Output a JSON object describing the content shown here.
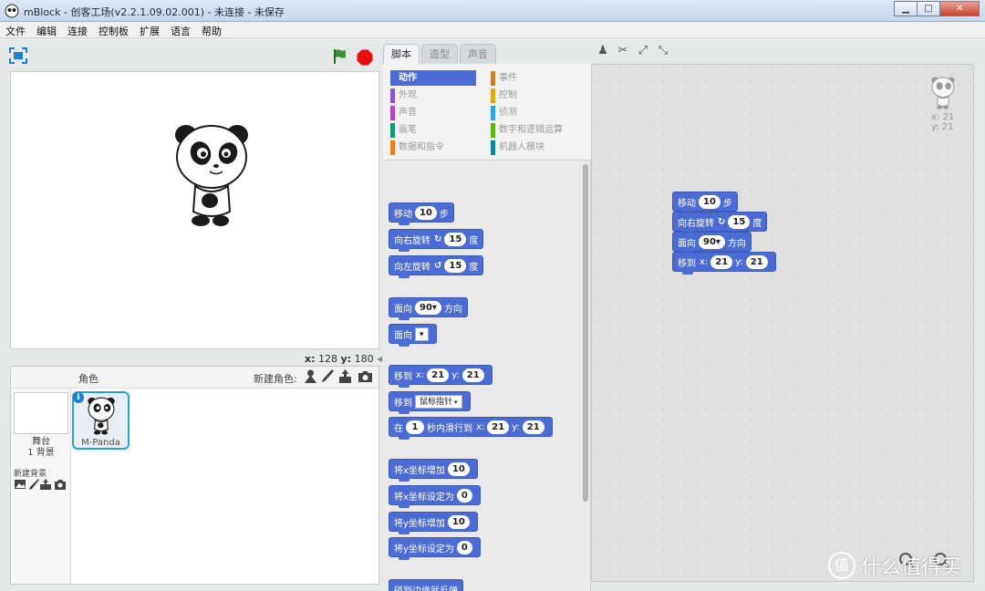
{
  "window": {
    "title": "mBlock - 创客工场(v2.2.1.09.02.001) - 未连接 - 未保存",
    "minimize": "▁",
    "maximize": "□",
    "close": "✕"
  },
  "menu": [
    "文件",
    "编辑",
    "连接",
    "控制板",
    "扩展",
    "语言",
    "帮助"
  ],
  "stage": {
    "coords": {
      "x_label": "x:",
      "x_value": "128",
      "y_label": "y:",
      "y_value": "180"
    }
  },
  "sprites": {
    "title": "角色",
    "new_sprite_label": "新建角色:",
    "stage_label_1": "舞台",
    "stage_label_2": "1 背景",
    "new_backdrop_label": "新建背景",
    "items": [
      {
        "name": "M-Panda",
        "info": "i"
      }
    ]
  },
  "tabs": [
    "脚本",
    "造型",
    "声音"
  ],
  "categories": [
    {
      "label": "动作",
      "color": "#4a6cd4",
      "active": true
    },
    {
      "label": "外观",
      "color": "#8a55d7"
    },
    {
      "label": "声音",
      "color": "#bb42c3"
    },
    {
      "label": "画笔",
      "color": "#0e9a6c"
    },
    {
      "label": "数据和指令",
      "color": "#ee7d16"
    },
    {
      "label": "事件",
      "color": "#c88330"
    },
    {
      "label": "控制",
      "color": "#e1a91a"
    },
    {
      "label": "侦测",
      "color": "#2ca5e2"
    },
    {
      "label": "数字和逻辑运算",
      "color": "#5cb712"
    },
    {
      "label": "机器人模块",
      "color": "#0c8799"
    }
  ],
  "palette_blocks": {
    "move": {
      "a": "移动",
      "v": "10",
      "b": "步"
    },
    "turn_right": {
      "a": "向右旋转",
      "icon": "↻",
      "v": "15",
      "b": "度"
    },
    "turn_left": {
      "a": "向左旋转",
      "icon": "↺",
      "v": "15",
      "b": "度"
    },
    "point_dir": {
      "a": "面向",
      "v": "90▾",
      "b": "方向"
    },
    "point_toward": {
      "a": "面向",
      "dd": "▾"
    },
    "goto_xy": {
      "a": "移到",
      "xl": "x:",
      "x": "21",
      "yl": "y:",
      "y": "21"
    },
    "goto": {
      "a": "移到",
      "dd": "鼠标指针",
      "tri": "▾"
    },
    "glide": {
      "a": "在",
      "v": "1",
      "b": "秒内滑行到",
      "xl": "x:",
      "x": "21",
      "yl": "y:",
      "y": "21"
    },
    "change_x": {
      "a": "将x坐标增加",
      "v": "10"
    },
    "set_x": {
      "a": "将x坐标设定为",
      "v": "0"
    },
    "change_y": {
      "a": "将y坐标增加",
      "v": "10"
    },
    "set_y": {
      "a": "将y坐标设定为",
      "v": "0"
    },
    "bounce": {
      "a": "碰到边缘就反弹"
    }
  },
  "script": {
    "move": {
      "a": "移动",
      "v": "10",
      "b": "步"
    },
    "turn": {
      "a": "向右旋转",
      "icon": "↻",
      "v": "15",
      "b": "度"
    },
    "point": {
      "a": "面向",
      "v": "90▾",
      "b": "方向"
    },
    "goto": {
      "a": "移到",
      "xl": "x:",
      "x": "21",
      "yl": "y:",
      "y": "21"
    }
  },
  "script_sprite_xy": {
    "x": "x: 21",
    "y": "y: 21"
  },
  "watermark": {
    "logo": "值",
    "text": "什么值得买"
  }
}
